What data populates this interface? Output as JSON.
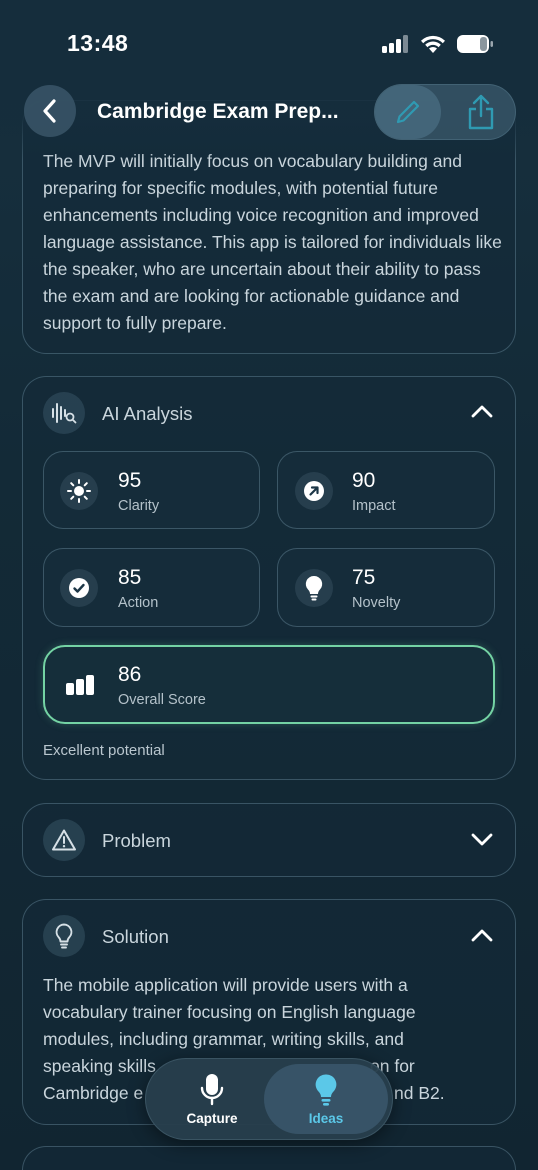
{
  "status_bar": {
    "time": "13:48"
  },
  "header": {
    "title": "Cambridge Exam Prep...",
    "back_icon": "chevron-left-icon",
    "edit_icon": "pencil-icon",
    "share_icon": "share-icon"
  },
  "description": {
    "text": "The MVP will initially focus on vocabulary building and preparing for specific modules, with potential future enhancements including voice recognition and improved language assistance. This app is tailored for individuals like the speaker, who are uncertain about their ability to pass the exam and are looking for actionable guidance and support to fully prepare."
  },
  "ai_analysis": {
    "title": "AI Analysis",
    "metrics": [
      {
        "value": "95",
        "label": "Clarity",
        "icon": "sun-icon"
      },
      {
        "value": "90",
        "label": "Impact",
        "icon": "arrow-up-right-icon"
      },
      {
        "value": "85",
        "label": "Action",
        "icon": "check-circle-icon"
      },
      {
        "value": "75",
        "label": "Novelty",
        "icon": "lightbulb-icon"
      }
    ],
    "overall": {
      "value": "86",
      "label": "Overall Score",
      "icon": "bar-chart-icon"
    },
    "verdict": "Excellent potential"
  },
  "problem": {
    "title": "Problem"
  },
  "solution": {
    "title": "Solution",
    "line1": "The mobile application will provide users with a",
    "line2": "vocabulary trainer focusing on English language",
    "line3": "modules, including grammar, writing skills, and",
    "line4a": "speaking skills",
    "line4b": "on for",
    "line5a": "Cambridge e",
    "line5b": "nd B2."
  },
  "tabbar": {
    "capture": "Capture",
    "ideas": "Ideas"
  },
  "colors": {
    "accent_green": "#74d3a4",
    "active_tab": "#5bc8e8"
  }
}
